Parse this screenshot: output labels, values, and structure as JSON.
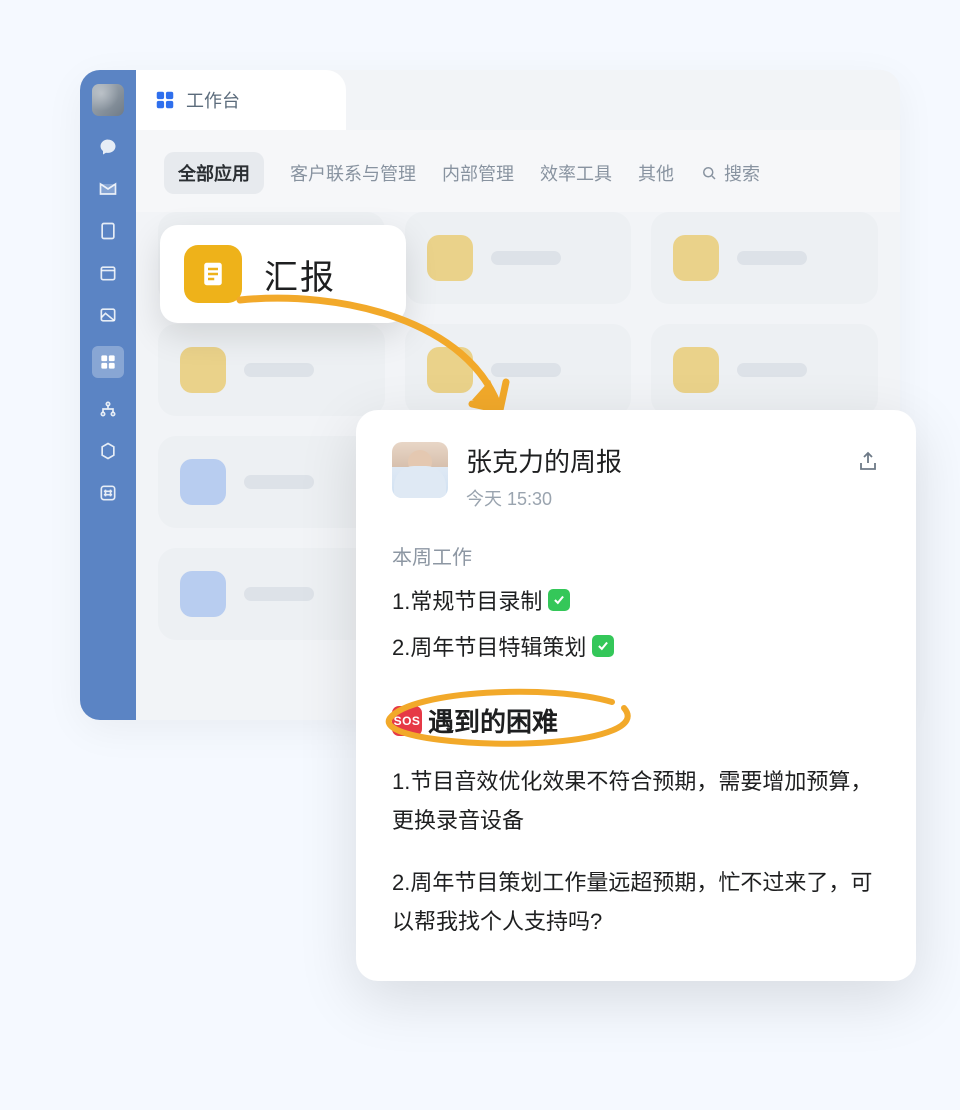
{
  "titlebar": {
    "label": "工作台"
  },
  "tabs": {
    "items": [
      {
        "label": "全部应用",
        "active": true
      },
      {
        "label": "客户联系与管理"
      },
      {
        "label": "内部管理"
      },
      {
        "label": "效率工具"
      },
      {
        "label": "其他"
      }
    ],
    "search_label": "搜索"
  },
  "feature": {
    "label": "汇报"
  },
  "report": {
    "title": "张克力的周报",
    "time": "今天 15:30",
    "section_week": "本周工作",
    "week_items": [
      "1.常规节目录制",
      "2.周年节目特辑策划 "
    ],
    "difficulty_heading": "遇到的困难",
    "sos_label": "SOS",
    "difficulty_items": [
      "1.节目音效优化效果不符合预期，需要增加预算，更换录音设备",
      "2.周年节目策划工作量远超预期，忙不过来了，可以帮我找个人支持吗?"
    ]
  },
  "colors": {
    "accent_orange": "#f2a92a",
    "brand_blue": "#5b84c4"
  }
}
